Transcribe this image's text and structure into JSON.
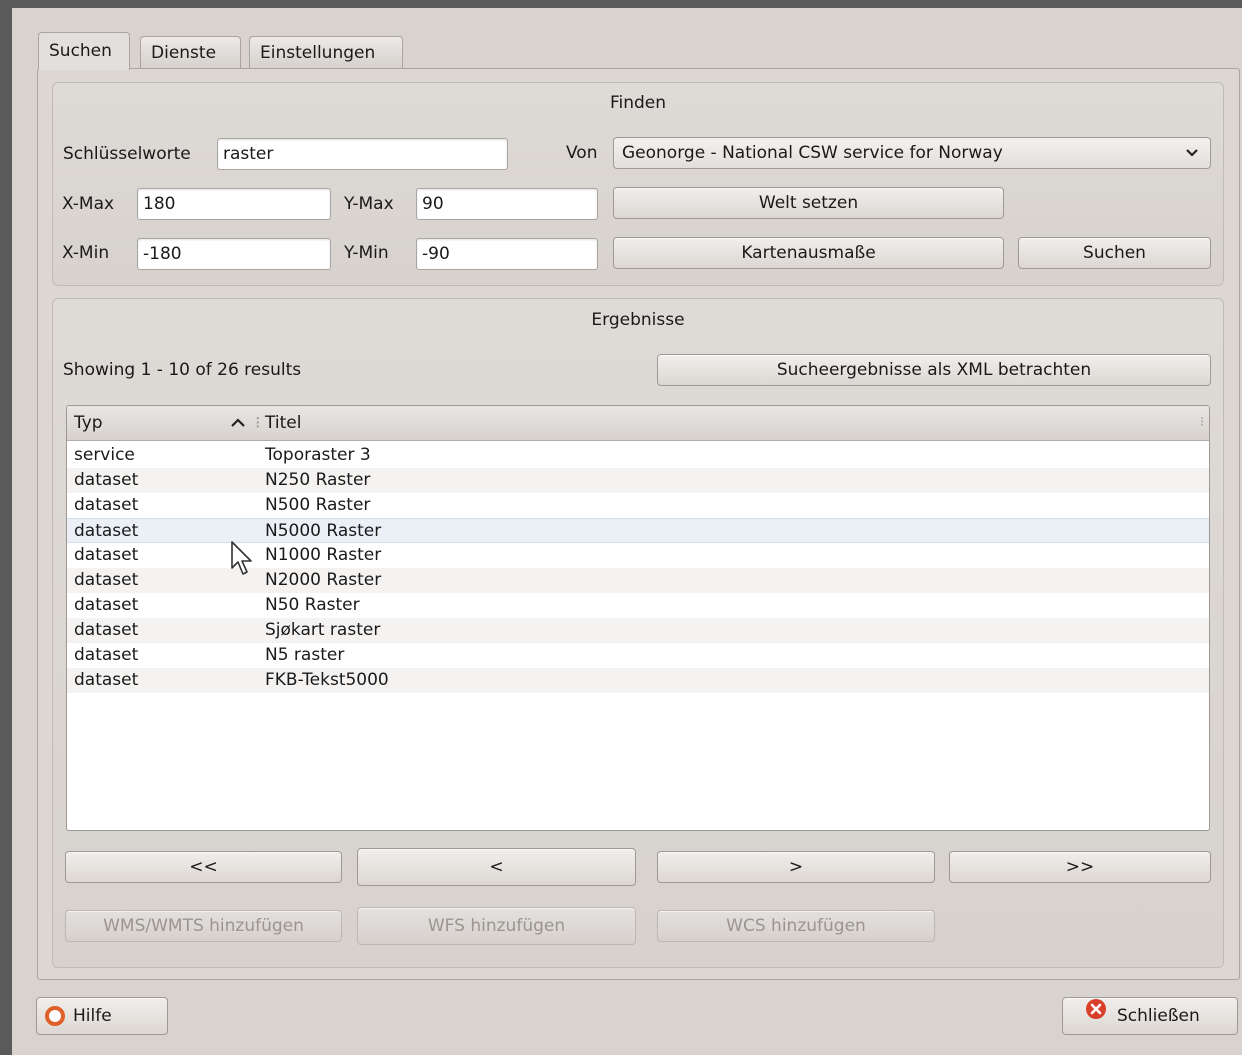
{
  "tabs": [
    {
      "label": "Suchen"
    },
    {
      "label": "Dienste"
    },
    {
      "label": "Einstellungen"
    }
  ],
  "find": {
    "title": "Finden",
    "keywords_label": "Schlüsselworte",
    "keywords_value": "raster",
    "from_label": "Von",
    "service_selected": "Geonorge - National CSW service for Norway",
    "xmax_label": "X-Max",
    "xmax_value": "180",
    "ymax_label": "Y-Max",
    "ymax_value": "90",
    "xmin_label": "X-Min",
    "xmin_value": "-180",
    "ymin_label": "Y-Min",
    "ymin_value": "-90",
    "world_button": "Welt setzen",
    "extent_button": "Kartenausmaße",
    "search_button": "Suchen"
  },
  "results": {
    "title": "Ergebnisse",
    "summary": "Showing 1 - 10 of 26 results",
    "xml_button": "Sucheergebnisse als XML betrachten",
    "columns": [
      "Typ",
      "Titel"
    ],
    "rows": [
      {
        "typ": "service",
        "titel": "Toporaster 3"
      },
      {
        "typ": "dataset",
        "titel": "N250 Raster"
      },
      {
        "typ": "dataset",
        "titel": "N500 Raster"
      },
      {
        "typ": "dataset",
        "titel": "N5000 Raster"
      },
      {
        "typ": "dataset",
        "titel": "N1000 Raster"
      },
      {
        "typ": "dataset",
        "titel": "N2000 Raster"
      },
      {
        "typ": "dataset",
        "titel": "N50 Raster"
      },
      {
        "typ": "dataset",
        "titel": "Sjøkart raster"
      },
      {
        "typ": "dataset",
        "titel": "N5 raster"
      },
      {
        "typ": "dataset",
        "titel": "FKB-Tekst5000"
      }
    ],
    "nav": [
      "<<",
      "<",
      ">",
      ">>"
    ],
    "add_wms": "WMS/WMTS hinzufügen",
    "add_wfs": "WFS hinzufügen",
    "add_wcs": "WCS hinzufügen"
  },
  "footer": {
    "help_label": "Hilfe",
    "close_label": "Schließen"
  },
  "colors": {
    "close_icon": "#d8402a",
    "help_icon": "#e0602a"
  }
}
